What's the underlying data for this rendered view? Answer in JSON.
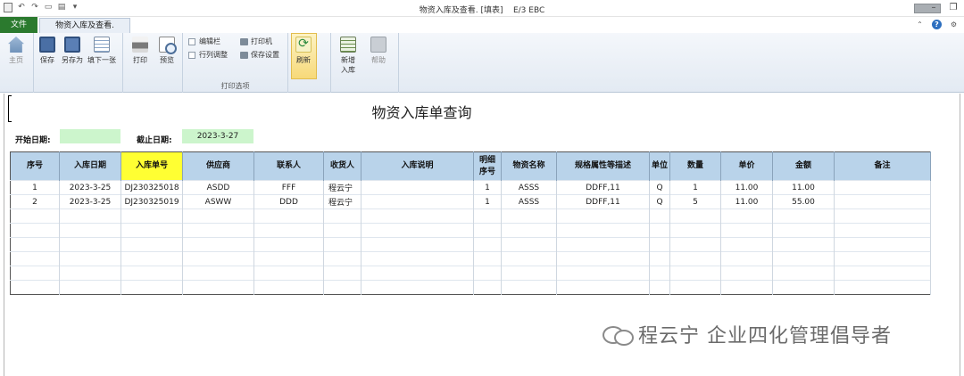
{
  "window": {
    "title": "物资入库及查看. [填表]",
    "edition": "E/3 EBC"
  },
  "tabs": {
    "file": "文件",
    "document": "物资入库及查看."
  },
  "ribbon": {
    "home": "主页",
    "save": "保存",
    "save_as": "另存为",
    "fill_next": "填下一张",
    "print": "打印",
    "preview": "预览",
    "edit_bar": "编辑栏",
    "row_col_adjust": "行列调整",
    "printer": "打印机",
    "save_settings": "保存设置",
    "print_options_group": "打印选项",
    "refresh": "刷新",
    "new_inbound_line1": "新增",
    "new_inbound_line2": "入库",
    "help": "帮助"
  },
  "report": {
    "title": "物资入库单查询",
    "start_date_label": "开始日期:",
    "start_date_value": "",
    "end_date_label": "截止日期:",
    "end_date_value": "2023-3-27"
  },
  "table": {
    "headers": [
      "序号",
      "入库日期",
      "入库单号",
      "供应商",
      "联系人",
      "收货人",
      "入库说明",
      "明细\n序号",
      "物资名称",
      "规格属性等描述",
      "单位",
      "数量",
      "单价",
      "金额",
      "备注"
    ],
    "rows": [
      [
        "1",
        "2023-3-25",
        "DJ230325018",
        "ASDD",
        "FFF",
        "程云宁",
        "",
        "1",
        "ASSS",
        "DDFF,11",
        "Q",
        "1",
        "11.00",
        "11.00",
        ""
      ],
      [
        "2",
        "2023-3-25",
        "DJ230325019",
        "ASWW",
        "DDD",
        "程云宁",
        "",
        "1",
        "ASSS",
        "DDFF,11",
        "Q",
        "5",
        "11.00",
        "55.00",
        ""
      ]
    ],
    "empty_rows": 6
  },
  "watermark": "程云宁 企业四化管理倡导者",
  "colors": {
    "header_bg": "#b9d3ea",
    "highlight_header": "#ffff33",
    "date_input_bg": "#ccf5cc",
    "file_tab_bg": "#2b7a2e"
  }
}
